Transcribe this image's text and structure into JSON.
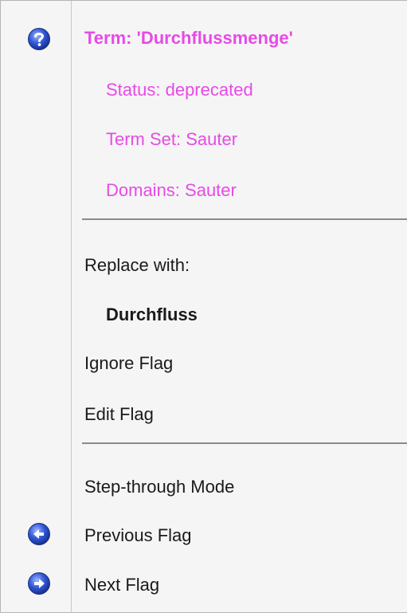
{
  "term": {
    "title": "Term: 'Durchflussmenge'",
    "status": "Status: deprecated",
    "term_set": "Term Set: Sauter",
    "domains": "Domains: Sauter"
  },
  "actions": {
    "replace_label": "Replace with:",
    "replacement": "Durchfluss",
    "ignore_flag": "Ignore Flag",
    "edit_flag": "Edit Flag"
  },
  "navigation": {
    "step_through": "Step-through Mode",
    "previous_flag": "Previous Flag",
    "next_flag": "Next Flag"
  },
  "icons": {
    "help": "help-icon",
    "previous": "arrow-left-icon",
    "next": "arrow-right-icon"
  },
  "colors": {
    "term_info": "#e64be6",
    "icon_blue": "#2448c8"
  }
}
